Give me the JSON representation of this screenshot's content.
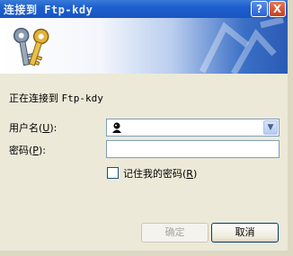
{
  "window": {
    "title": "连接到 Ftp-kdy",
    "help_button": "?",
    "close_button": "X"
  },
  "message": {
    "prefix": "正在连接到 ",
    "host": "Ftp-kdy"
  },
  "username": {
    "label": "用户名",
    "accel_open": "(",
    "accel": "U",
    "accel_close": "):",
    "value": ""
  },
  "password": {
    "label": "密码",
    "accel_open": "(",
    "accel": "P",
    "accel_close": "):",
    "value": ""
  },
  "remember": {
    "label": "记住我的密码",
    "accel_open": "(",
    "accel": "R",
    "accel_close": ")",
    "checked": false
  },
  "buttons": {
    "ok": "确定",
    "cancel": "取消"
  },
  "icons": {
    "banner": "keys-icon",
    "user": "user-icon",
    "dropdown": "chevron-down-icon"
  }
}
